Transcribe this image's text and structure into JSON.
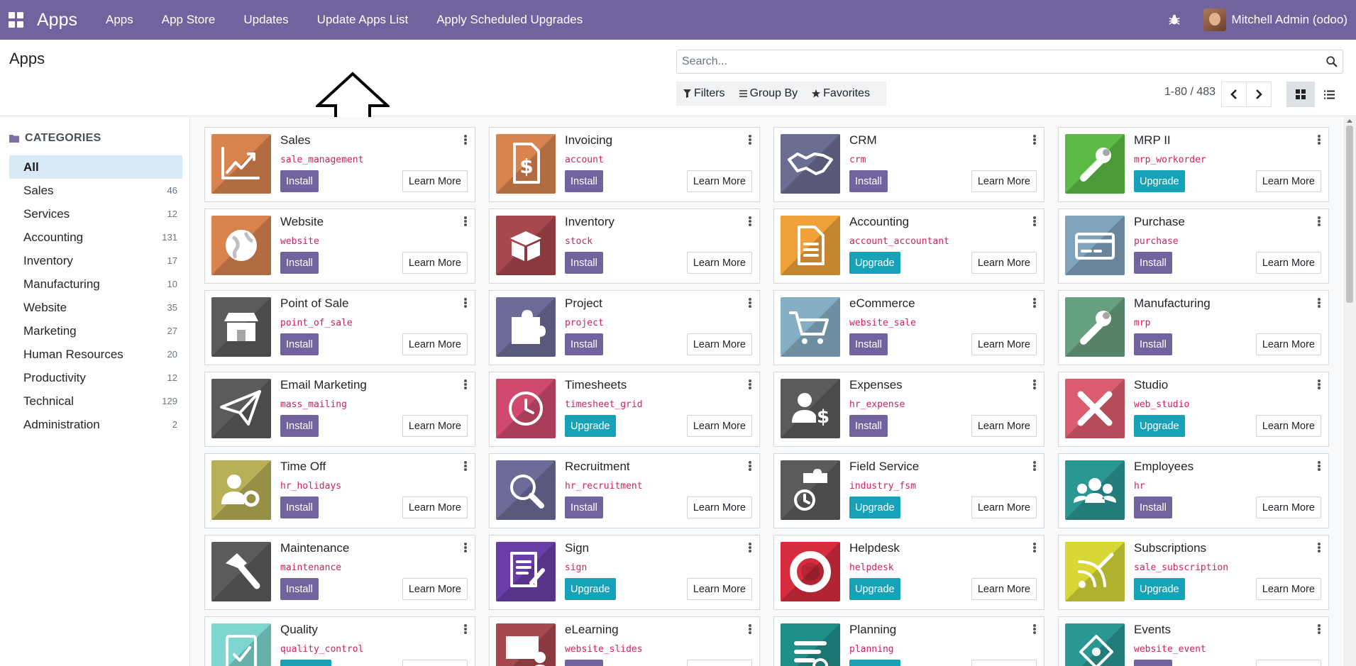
{
  "navbar": {
    "brand": "Apps",
    "menu": [
      {
        "label": "Apps"
      },
      {
        "label": "App Store"
      },
      {
        "label": "Updates"
      },
      {
        "label": "Update Apps List"
      },
      {
        "label": "Apply Scheduled Upgrades"
      }
    ],
    "user_name": "Mitchell Admin (odoo)",
    "color": "#71639e"
  },
  "control_panel": {
    "title": "Apps",
    "search_placeholder": "Search...",
    "filters_label": "Filters",
    "groupby_label": "Group By",
    "favorites_label": "Favorites",
    "pager": "1-80 / 483"
  },
  "sidebar": {
    "heading": "CATEGORIES",
    "items": [
      {
        "label": "All",
        "count": ""
      },
      {
        "label": "Sales",
        "count": "46"
      },
      {
        "label": "Services",
        "count": "12"
      },
      {
        "label": "Accounting",
        "count": "131"
      },
      {
        "label": "Inventory",
        "count": "17"
      },
      {
        "label": "Manufacturing",
        "count": "10"
      },
      {
        "label": "Website",
        "count": "35"
      },
      {
        "label": "Marketing",
        "count": "27"
      },
      {
        "label": "Human Resources",
        "count": "20"
      },
      {
        "label": "Productivity",
        "count": "12"
      },
      {
        "label": "Technical",
        "count": "129"
      },
      {
        "label": "Administration",
        "count": "2"
      }
    ]
  },
  "labels": {
    "learn_more": "Learn More"
  },
  "apps": [
    {
      "name": "Sales",
      "tech": "sale_management",
      "action": "Install",
      "color": "#d9834f",
      "icon": "chart-up"
    },
    {
      "name": "Invoicing",
      "tech": "account",
      "action": "Install",
      "color": "#d9834f",
      "icon": "invoice-dollar"
    },
    {
      "name": "CRM",
      "tech": "crm",
      "action": "Install",
      "color": "#6b6d92",
      "icon": "handshake"
    },
    {
      "name": "MRP II",
      "tech": "mrp_workorder",
      "action": "Upgrade",
      "color": "#5bbb45",
      "icon": "wrench"
    },
    {
      "name": "Website",
      "tech": "website",
      "action": "Install",
      "color": "#d9834f",
      "icon": "globe"
    },
    {
      "name": "Inventory",
      "tech": "stock",
      "action": "Install",
      "color": "#a8474c",
      "icon": "box"
    },
    {
      "name": "Accounting",
      "tech": "account_accountant",
      "action": "Upgrade",
      "color": "#f0a13a",
      "icon": "document"
    },
    {
      "name": "Purchase",
      "tech": "purchase",
      "action": "Install",
      "color": "#7fa2bd",
      "icon": "credit-card"
    },
    {
      "name": "Point of Sale",
      "tech": "point_of_sale",
      "action": "Install",
      "color": "#5b5b5b",
      "icon": "store"
    },
    {
      "name": "Project",
      "tech": "project",
      "action": "Install",
      "color": "#6f6b98",
      "icon": "puzzle"
    },
    {
      "name": "eCommerce",
      "tech": "website_sale",
      "action": "Install",
      "color": "#86aec6",
      "icon": "cart"
    },
    {
      "name": "Manufacturing",
      "tech": "mrp",
      "action": "Install",
      "color": "#67a07e",
      "icon": "wrench"
    },
    {
      "name": "Email Marketing",
      "tech": "mass_mailing",
      "action": "Install",
      "color": "#5b5b5b",
      "icon": "paper-plane"
    },
    {
      "name": "Timesheets",
      "tech": "timesheet_grid",
      "action": "Upgrade",
      "color": "#cf4a6c",
      "icon": "clock"
    },
    {
      "name": "Expenses",
      "tech": "hr_expense",
      "action": "Install",
      "color": "#5b5b5b",
      "icon": "user-dollar"
    },
    {
      "name": "Studio",
      "tech": "web_studio",
      "action": "Upgrade",
      "color": "#db5b6f",
      "icon": "tools"
    },
    {
      "name": "Time Off",
      "tech": "hr_holidays",
      "action": "Install",
      "color": "#b7b057",
      "icon": "user-gear"
    },
    {
      "name": "Recruitment",
      "tech": "hr_recruitment",
      "action": "Install",
      "color": "#6f6b98",
      "icon": "magnifier"
    },
    {
      "name": "Field Service",
      "tech": "industry_fsm",
      "action": "Upgrade",
      "color": "#5b5b5b",
      "icon": "puzzle-clock"
    },
    {
      "name": "Employees",
      "tech": "hr",
      "action": "Install",
      "color": "#2b9792",
      "icon": "users"
    },
    {
      "name": "Maintenance",
      "tech": "maintenance",
      "action": "Install",
      "color": "#5b5b5b",
      "icon": "hammer"
    },
    {
      "name": "Sign",
      "tech": "sign",
      "action": "Upgrade",
      "color": "#6a3ea8",
      "icon": "sign-document"
    },
    {
      "name": "Helpdesk",
      "tech": "helpdesk",
      "action": "Upgrade",
      "color": "#d62c3e",
      "icon": "lifebuoy"
    },
    {
      "name": "Subscriptions",
      "tech": "sale_subscription",
      "action": "Upgrade",
      "color": "#d7d838",
      "icon": "rss-pen"
    },
    {
      "name": "Quality",
      "tech": "quality_control",
      "action": "Upgrade",
      "color": "#7dd7d0",
      "icon": "clipboard-check"
    },
    {
      "name": "eLearning",
      "tech": "website_slides",
      "action": "Install",
      "color": "#a8474c",
      "icon": "presentation"
    },
    {
      "name": "Planning",
      "tech": "planning",
      "action": "Upgrade",
      "color": "#1f9088",
      "icon": "planning"
    },
    {
      "name": "Events",
      "tech": "website_event",
      "action": "Install",
      "color": "#2b9792",
      "icon": "ticket"
    }
  ]
}
